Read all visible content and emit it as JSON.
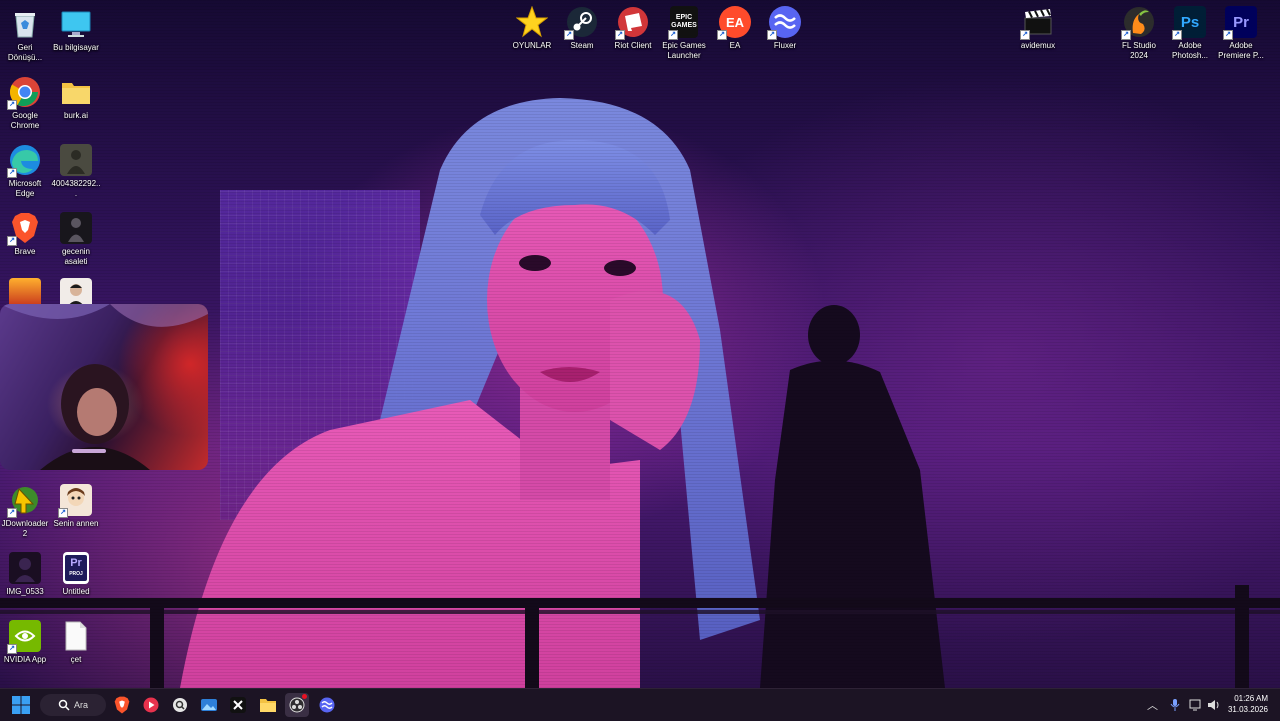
{
  "desktop": {
    "left_icons": [
      {
        "label": "Geri Dönüşü...",
        "icon": "recycle-bin-icon"
      },
      {
        "label": "Bu bilgisayar",
        "icon": "monitor-icon"
      },
      {
        "label": "Google Chrome",
        "icon": "chrome-icon"
      },
      {
        "label": "burk.ai",
        "icon": "folder-icon"
      },
      {
        "label": "Microsoft Edge",
        "icon": "edge-icon"
      },
      {
        "label": "4004382292...",
        "icon": "image-file-icon"
      },
      {
        "label": "Brave",
        "icon": "brave-icon"
      },
      {
        "label": "gecenin asaleti",
        "icon": "image-file-icon"
      },
      {
        "label": "JDownloader 2",
        "icon": "jdownloader-icon"
      },
      {
        "label": "Senin annen",
        "icon": "image-file-icon"
      },
      {
        "label": "IMG_0533",
        "icon": "image-file-icon"
      },
      {
        "label": "Untitled",
        "icon": "premiere-project-icon"
      },
      {
        "label": "NVIDIA App",
        "icon": "nvidia-icon"
      },
      {
        "label": "çet",
        "icon": "text-file-icon"
      }
    ],
    "top_icons": [
      {
        "label": "OYUNLAR",
        "icon": "star-folder-icon"
      },
      {
        "label": "Steam",
        "icon": "steam-icon"
      },
      {
        "label": "Riot Client",
        "icon": "riot-icon"
      },
      {
        "label": "Epic Games Launcher",
        "icon": "epic-games-icon",
        "glyph": "EPIC\nGAMES"
      },
      {
        "label": "EA",
        "icon": "ea-icon",
        "glyph": "EA"
      },
      {
        "label": "Fluxer",
        "icon": "fluxer-icon"
      }
    ],
    "right_icons": [
      {
        "label": "avidemux",
        "icon": "clapperboard-icon"
      },
      {
        "label": "FL Studio 2024",
        "icon": "fl-studio-icon"
      },
      {
        "label": "Adobe Photosh...",
        "icon": "photoshop-icon",
        "glyph": "Ps"
      },
      {
        "label": "Adobe Premiere P...",
        "icon": "premiere-icon",
        "glyph": "Pr"
      }
    ]
  },
  "taskbar": {
    "search_label": "Ara",
    "pinned": [
      {
        "icon": "brave-icon"
      },
      {
        "icon": "media-player-icon"
      },
      {
        "icon": "search-app-icon"
      },
      {
        "icon": "photos-icon"
      },
      {
        "icon": "capcut-icon"
      },
      {
        "icon": "file-explorer-icon"
      },
      {
        "icon": "obs-icon"
      },
      {
        "icon": "fluxer-icon"
      }
    ],
    "time": "01:26 AM",
    "date": "31.03.2026"
  },
  "colors": {
    "taskbar_bg": "#1c1424",
    "wallpaper_accent": "#c83cbe",
    "hair_blue": "#6a7fd8"
  }
}
